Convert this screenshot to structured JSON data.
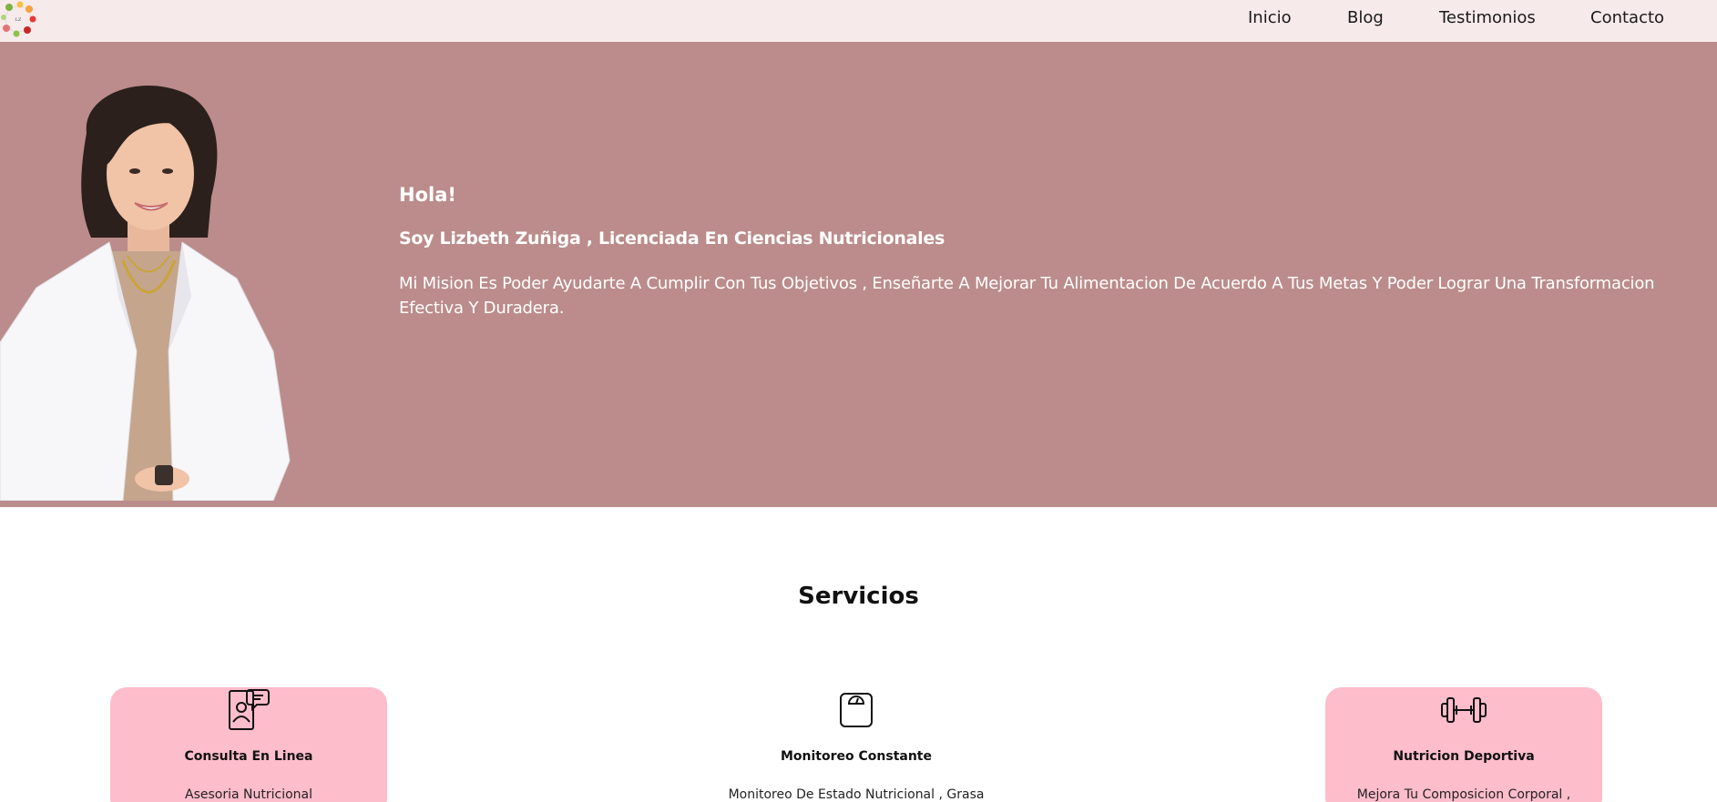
{
  "nav": {
    "items": [
      {
        "label": "Inicio"
      },
      {
        "label": "Blog"
      },
      {
        "label": "Testimonios"
      },
      {
        "label": "Contacto"
      }
    ],
    "logo_icon": "fruit-wreath-logo"
  },
  "hero": {
    "greeting": "Hola!",
    "subtitle": "Soy Lizbeth Zuñiga , Licenciada En Ciencias Nutricionales",
    "body": "Mi Mision Es Poder Ayudarte A Cumplir Con Tus Objetivos , Enseñarte A Mejorar Tu Alimentacion De Acuerdo A Tus Metas Y Poder Lograr Una Transformacion Efectiva Y Duradera.",
    "background_color": "#bb8c8b"
  },
  "services": {
    "title": "Servicios",
    "cards": [
      {
        "title": "Consulta En Linea",
        "description": "Asesoria Nutricional",
        "icon": "online-consultation-icon",
        "highlight": true
      },
      {
        "title": "Monitoreo Constante",
        "description": "Monitoreo De Estado Nutricional , Grasa",
        "icon": "scale-icon",
        "highlight": false
      },
      {
        "title": "Nutricion Deportiva",
        "description": "Mejora Tu Composicion Corporal ,",
        "icon": "dumbbell-icon",
        "highlight": true
      }
    ],
    "card_color": "#fdbdcb"
  }
}
